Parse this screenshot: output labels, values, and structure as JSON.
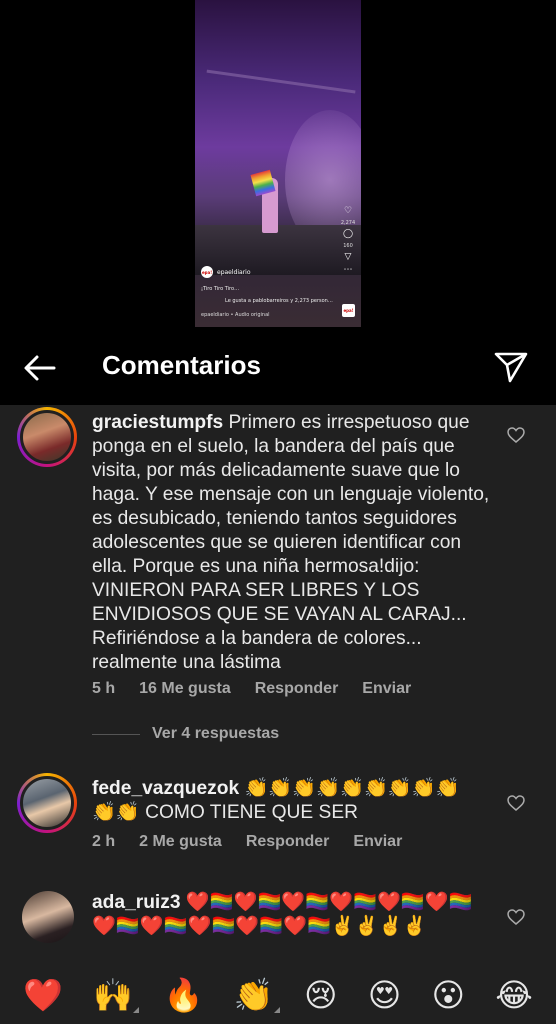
{
  "video": {
    "like_count": "2,274",
    "comment_count": "160",
    "account": "epaeldiario",
    "badge": "epa!",
    "caption": "¡Tiro Tiro Tiro…",
    "liked_by": "Le gusta a pablobarreiros y 2,273 person…",
    "audio": "epaeldiario • Audio original",
    "avatar_text": "epa!"
  },
  "header": {
    "title": "Comentarios"
  },
  "comments": [
    {
      "username": "graciestumpfs",
      "text": " Primero es irrespetuoso que ponga en el suelo, la bandera del país que visita,  por más delicadamente suave que lo haga. Y ese mensaje con un lenguaje violento, es desubicado, teniendo tantos seguidores adolescentes que se quieren identificar con ella. Porque es una niña hermosa!dijo: VINIERON PARA SER LIBRES Y LOS ENVIDIOSOS QUE SE VAYAN AL CARAJ... Refiriéndose a la bandera de colores... realmente una lástima",
      "time": "5 h",
      "likes": "16 Me gusta",
      "reply": "Responder",
      "send": "Enviar",
      "view_replies": "Ver 4 respuestas"
    },
    {
      "username": "fede_vazquezok",
      "text": " 👏👏👏👏👏👏👏👏👏👏👏 COMO TIENE QUE SER",
      "time": "2 h",
      "likes": "2 Me gusta",
      "reply": "Responder",
      "send": "Enviar"
    },
    {
      "username": "ada_ruiz3",
      "text": " ❤️🏳️‍🌈❤️🏳️‍🌈❤️🏳️‍🌈❤️🏳️‍🌈❤️🏳️‍🌈❤️🏳️‍🌈❤️🏳️‍🌈❤️🏳️‍🌈❤️🏳️‍🌈❤️🏳️‍🌈❤️🏳️‍🌈✌️✌️✌️✌️"
    }
  ],
  "emoji_bar": [
    "❤️",
    "🙌",
    "🔥",
    "👏",
    "😢",
    "😍",
    "😮",
    "😂"
  ]
}
